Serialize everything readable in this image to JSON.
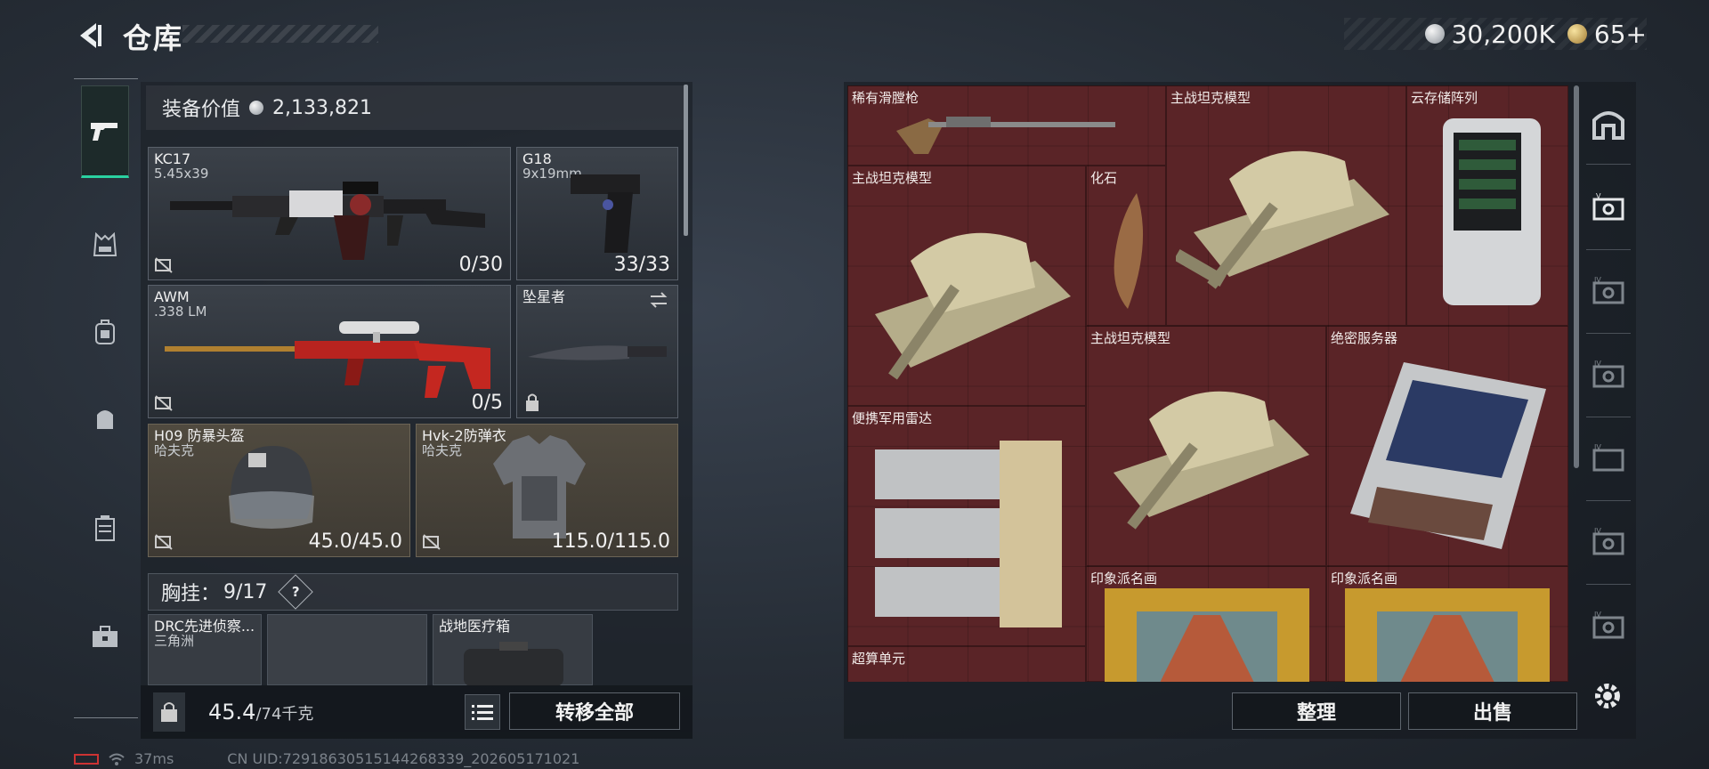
{
  "header": {
    "title": "仓库",
    "currencies": [
      {
        "icon": "silver-coin-icon",
        "value": "30,200K"
      },
      {
        "icon": "gold-coin-icon",
        "value": "65+"
      }
    ]
  },
  "equipment": {
    "value_label": "装备价值",
    "value": "2,133,821",
    "slots": [
      {
        "name": "KC17",
        "sub": "5.45x39",
        "count": "0/30"
      },
      {
        "name": "G18",
        "sub": "9x19mm",
        "count": "33/33"
      },
      {
        "name": "AWM",
        "sub": ".338 LM",
        "count": "0/5"
      },
      {
        "name": "坠星者",
        "sub": "",
        "count": ""
      },
      {
        "name": "H09 防暴头盔",
        "sub": "哈夫克",
        "count": "45.0/45.0"
      },
      {
        "name": "Hvk-2防弹衣",
        "sub": "哈夫克",
        "count": "115.0/115.0"
      }
    ],
    "vest": {
      "label": "胸挂：",
      "count": "9/17",
      "help": "?"
    },
    "vest_items": [
      {
        "name": "DRC先进侦察...",
        "sub": "三角洲"
      },
      {
        "name": "",
        "sub": ""
      },
      {
        "name": "战地医疗箱",
        "sub": ""
      }
    ],
    "weight": "45.4",
    "weight_max": "/74千克",
    "transfer_all": "转移全部"
  },
  "stash": {
    "items": [
      {
        "label": "稀有滑膛枪"
      },
      {
        "label": "主战坦克模型"
      },
      {
        "label": "云存储阵列"
      },
      {
        "label": "主战坦克模型"
      },
      {
        "label": "化石"
      },
      {
        "label": "主战坦克模型"
      },
      {
        "label": "绝密服务器"
      },
      {
        "label": "便携军用雷达"
      },
      {
        "label": "印象派名画"
      },
      {
        "label": "印象派名画"
      },
      {
        "label": "超算单元"
      }
    ],
    "sort_button": "整理",
    "sell_button": "出售"
  },
  "status": {
    "ping": "37ms",
    "uid": "CN UID:7291863051514426833​9_202605171021"
  },
  "colors": {
    "accent": "#2ad1a0",
    "stash_bg": "#5a2427"
  }
}
